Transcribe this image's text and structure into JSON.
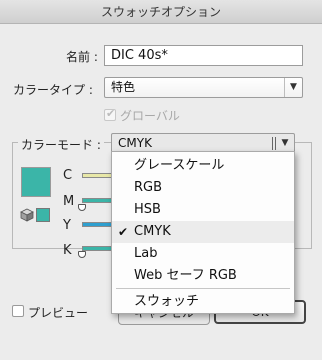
{
  "window": {
    "title": "スウォッチオプション"
  },
  "name_field": {
    "label": "名前 :",
    "value": "DIC 40s*"
  },
  "color_type": {
    "label": "カラータイプ :",
    "value": "特色"
  },
  "global": {
    "label": "グローバル",
    "checked": true,
    "enabled": false
  },
  "color_mode": {
    "label": "カラーモード :",
    "value": "CMYK",
    "options": [
      {
        "label": "グレースケール",
        "selected": false
      },
      {
        "label": "RGB",
        "selected": false
      },
      {
        "label": "HSB",
        "selected": false
      },
      {
        "label": "CMYK",
        "selected": true
      },
      {
        "label": "Lab",
        "selected": false
      },
      {
        "label": "Web セーフ RGB",
        "selected": false
      },
      {
        "label": "スウォッチ",
        "selected": false
      }
    ]
  },
  "channels": [
    {
      "label": "C",
      "track_color": "#e8e8a8"
    },
    {
      "label": "M",
      "track_color": "#3bb5a8"
    },
    {
      "label": "Y",
      "track_color": "#2e9fcf"
    },
    {
      "label": "K",
      "track_color": "#3bb5a8"
    }
  ],
  "swatch_color": "#3bb5a8",
  "preview": {
    "label": "プレビュー",
    "checked": false
  },
  "buttons": {
    "cancel": "キャンセル",
    "ok": "OK"
  },
  "icons": {
    "dropdown_arrow": "▼",
    "checkmark": "✔"
  }
}
